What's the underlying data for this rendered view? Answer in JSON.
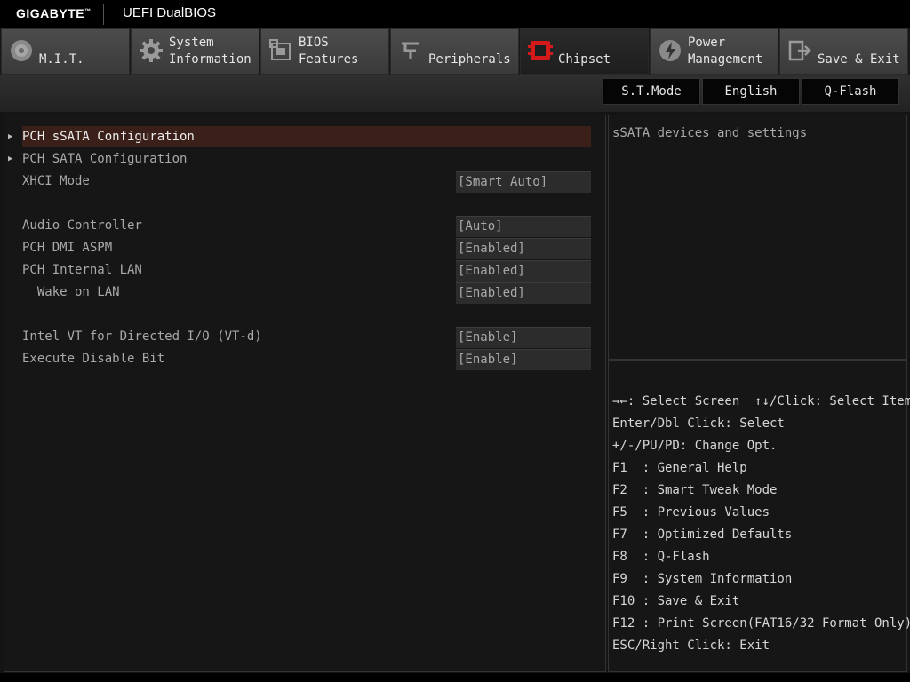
{
  "header": {
    "brand": "GIGABYTE",
    "trademark": "™",
    "product": "UEFI DualBIOS"
  },
  "tabs": [
    {
      "label": "M.I.T.",
      "icon": "mit-dial-icon",
      "active": false
    },
    {
      "label": "System\nInformation",
      "icon": "gear-icon",
      "active": false
    },
    {
      "label": "BIOS\nFeatures",
      "icon": "bios-chip-icon",
      "active": false
    },
    {
      "label": "Peripherals",
      "icon": "peripherals-icon",
      "active": false
    },
    {
      "label": "Chipset",
      "icon": "chipset-icon",
      "active": true
    },
    {
      "label": "Power\nManagement",
      "icon": "power-icon",
      "active": false
    },
    {
      "label": "Save & Exit",
      "icon": "exit-icon",
      "active": false
    }
  ],
  "toolbar": {
    "stmode": "S.T.Mode",
    "language": "English",
    "qflash": "Q-Flash"
  },
  "settings": [
    {
      "label": "PCH sSATA Configuration",
      "submenu": true,
      "selected": true
    },
    {
      "label": "PCH SATA Configuration",
      "submenu": true
    },
    {
      "label": "XHCI Mode",
      "value": "[Smart Auto]"
    },
    {
      "label": "Audio Controller",
      "value": "[Auto]"
    },
    {
      "label": "PCH DMI ASPM",
      "value": "[Enabled]"
    },
    {
      "label": "PCH Internal LAN",
      "value": "[Enabled]"
    },
    {
      "label": "  Wake on LAN",
      "value": "[Enabled]"
    },
    {
      "label": "Intel VT for Directed I/O (VT-d)",
      "value": "[Enable]"
    },
    {
      "label": "Execute Disable Bit",
      "value": "[Enable]"
    }
  ],
  "help": {
    "description": "sSATA devices and settings"
  },
  "keys": [
    "→←: Select Screen  ↑↓/Click: Select Item",
    "Enter/Dbl Click: Select",
    "+/-/PU/PD: Change Opt.",
    "F1  : General Help",
    "F2  : Smart Tweak Mode",
    "F5  : Previous Values",
    "F7  : Optimized Defaults",
    "F8  : Q-Flash",
    "F9  : System Information",
    "F10 : Save & Exit",
    "F12 : Print Screen(FAT16/32 Format Only)",
    "ESC/Right Click: Exit"
  ],
  "colors": {
    "accent": "#d41a1a",
    "selection": "#3b2019",
    "background": "#141414"
  }
}
